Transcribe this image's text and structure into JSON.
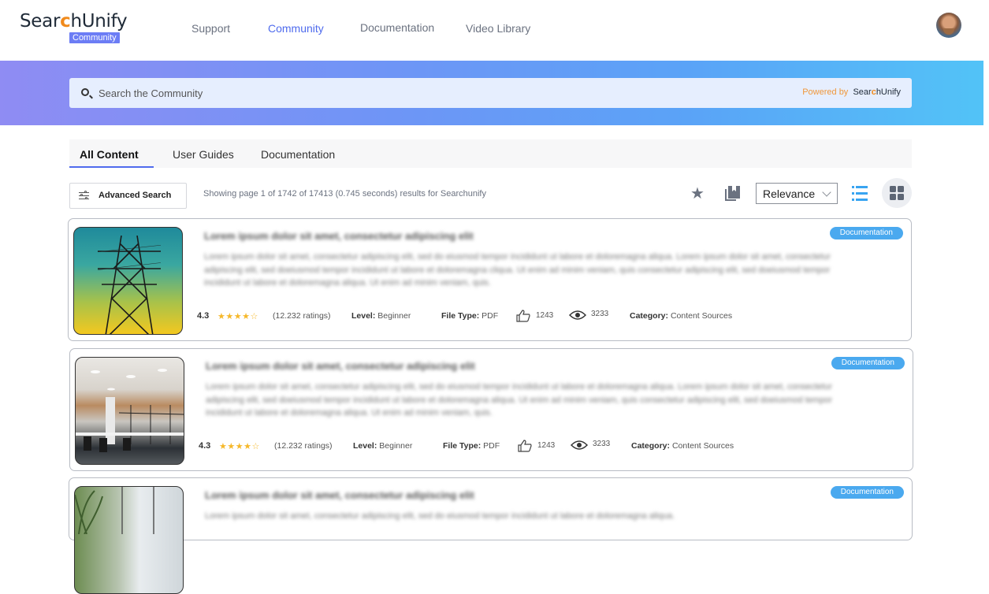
{
  "header": {
    "logo_text_before": "Sear",
    "logo_text_c": "c",
    "logo_text_after": "hUnify",
    "logo_badge": "Community",
    "nav": [
      {
        "label": "Support",
        "active": false
      },
      {
        "label": "Community",
        "active": true
      },
      {
        "label": "Documentation",
        "active": false
      },
      {
        "label": "Video Library",
        "active": false
      }
    ]
  },
  "search": {
    "placeholder": "Search the Community",
    "powered_by": "Powered by",
    "powered_brand_before": "Sear",
    "powered_brand_c": "c",
    "powered_brand_after": "hUnify"
  },
  "tabs": [
    {
      "label": "All Content",
      "active": true
    },
    {
      "label": "User Guides",
      "active": false
    },
    {
      "label": "Documentation",
      "active": false
    }
  ],
  "toolbar": {
    "advanced_search_label": "Advanced Search",
    "result_info": "Showing page 1 of 1742 of 17413  (0.745 seconds) results for Searchunify",
    "sort_selected": "Relevance"
  },
  "results": [
    {
      "badge": "Documentation",
      "title": "Lorem ipsum dolor sit amet, consectetur adipiscing elit",
      "description": "Lorem ipsum dolor sit amet, consectetur adipiscing elit, sed do eiusmod tempor incididunt ut labore et doloremagna aliqua. Lorem ipsum dolor sit amet, consectetur adipiscing elit, sed doeiusmod tempor incididunt ut labore et doloremagna cliqua. Ut enim ad minim veniam, quis consectetur adipiscing elit, sed doeiusmod tempor incididunt ut labore et doloremagna aliqua. Ut enim ad minim veniam, quis.",
      "rating": "4.3",
      "stars": "★★★★☆",
      "ratings_count": "(12.232 ratings)",
      "level_label": "Level:",
      "level": "Beginner",
      "filetype_label": "File Type:",
      "filetype": "PDF",
      "likes": "1243",
      "views": "3233",
      "category_label": "Category:",
      "category": "Content Sources",
      "image": "power-tower-image"
    },
    {
      "badge": "Documentation",
      "title": "Lorem ipsum dolor sit amet, consectetur adipiscing elit",
      "description": "Lorem ipsum dolor sit amet, consectetur adipiscing elit, sed do eiusmod tempor incididunt ut labore et doloremagna aliqua. Lorem ipsum dolor sit amet, consectetur adipiscing elit, sed doeiusmod tempor incididunt ut labore et doloremagna aliqua. Ut enim ad minim veniam, quis consectetur adipiscing elit, sed doeiusmod tempor incididunt ut labore et doloremagna aliqua. Ut enim ad minim veniam, quis.",
      "rating": "4.3",
      "stars": "★★★★☆",
      "ratings_count": "(12.232 ratings)",
      "level_label": "Level:",
      "level": "Beginner",
      "filetype_label": "File Type:",
      "filetype": "PDF",
      "likes": "1243",
      "views": "3233",
      "category_label": "Category:",
      "category": "Content Sources",
      "image": "office-interior-image"
    },
    {
      "badge": "Documentation",
      "title": "Lorem ipsum dolor sit amet, consectetur adipiscing elit",
      "description": "Lorem ipsum dolor sit amet, consectetur adipiscing elit, sed do eiusmod tempor incididunt ut labore et doloremagna aliqua.",
      "image": "plant-window-image"
    }
  ],
  "colors": {
    "accent": "#4f6bed",
    "badge": "#4aa9ef",
    "star": "#f6b82a",
    "brand_orange": "#f08a1c"
  }
}
